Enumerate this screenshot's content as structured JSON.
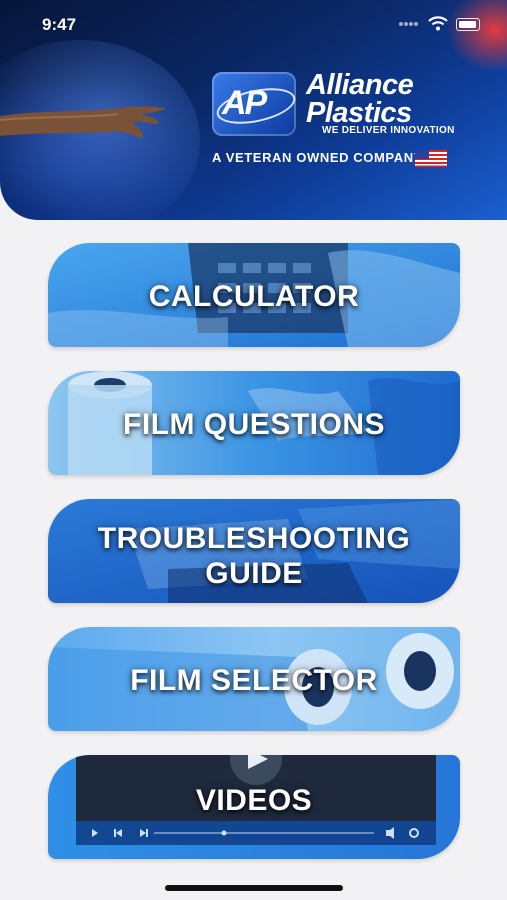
{
  "status_bar": {
    "time": "9:47"
  },
  "header": {
    "logo_initials": "AP",
    "brand_line1": "Alliance",
    "brand_line2": "Plastics",
    "tagline": "WE DELIVER INNOVATION",
    "veteran_text": "A VETERAN OWNED COMPANY"
  },
  "menu": {
    "items": [
      {
        "label": "CALCULATOR",
        "icon": "calculator-photo"
      },
      {
        "label": "FILM QUESTIONS",
        "icon": "film-roll-photo"
      },
      {
        "label_line1": "TROUBLESHOOTING",
        "label_line2": "GUIDE",
        "icon": "documents-photo"
      },
      {
        "label": "FILM SELECTOR",
        "icon": "film-rolls-photo"
      },
      {
        "label": "VIDEOS",
        "icon": "video-player"
      }
    ]
  },
  "colors": {
    "header_dark": "#07153a",
    "header_blue": "#1b5fd0",
    "button_blue": "#2f8fe6",
    "accent_red": "#eb3c3c",
    "background": "#f2f2f4"
  }
}
